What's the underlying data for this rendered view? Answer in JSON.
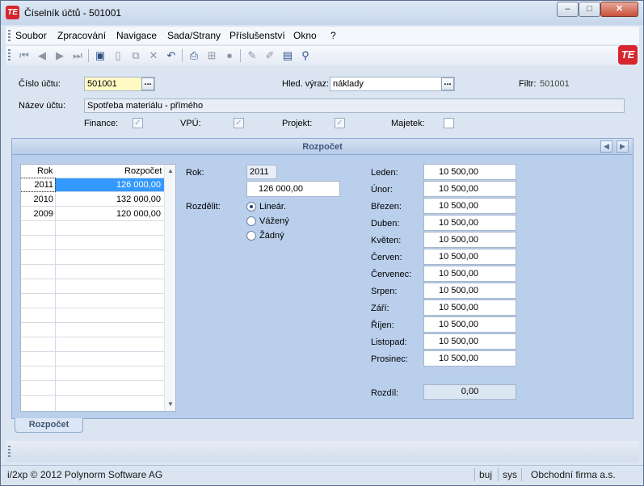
{
  "window": {
    "title": "Číselník účtů - 501001",
    "app_icon": "TE",
    "minimize": "–",
    "maximize": "□",
    "close": "✕"
  },
  "menu": [
    "Soubor",
    "Zpracování",
    "Navigace",
    "Sada/Strany",
    "Příslušenství",
    "Okno",
    "?"
  ],
  "toolbar_icons": [
    "first-icon",
    "previous-icon",
    "next-icon",
    "last-icon",
    "save-icon",
    "new-icon",
    "copy-icon",
    "delete-icon",
    "undo-icon",
    "print-icon",
    "structure-icon",
    "disc-icon",
    "pen-icon",
    "eraser-icon",
    "notes-icon",
    "filter-icon"
  ],
  "brand": "TE",
  "header": {
    "account_label": "Číslo účtu:",
    "account_value": "501001",
    "browse": "...",
    "search_label": "Hled. výraz:",
    "search_value": "náklady",
    "filter_label": "Filtr:",
    "filter_value": "501001",
    "name_label": "Název účtu:",
    "name_value": "Spotřeba materiálu - přímého",
    "checks": [
      {
        "label": "Finance:",
        "checked": true
      },
      {
        "label": "VPÚ:",
        "checked": true
      },
      {
        "label": "Projekt:",
        "checked": true
      },
      {
        "label": "Majetek:",
        "checked": false
      }
    ],
    "check_mark": "✓"
  },
  "panel": {
    "title": "Rozpočet",
    "prev": "◀",
    "next": "▶"
  },
  "grid": {
    "columns": [
      "Rok",
      "Rozpočet"
    ],
    "rows": [
      {
        "rok": "2011",
        "rozpocet": "126 000,00",
        "selected": true
      },
      {
        "rok": "2010",
        "rozpocet": "132 000,00",
        "selected": false
      },
      {
        "rok": "2009",
        "rozpocet": "120 000,00",
        "selected": false
      }
    ],
    "scroll_up": "▲",
    "scroll_down": "▼"
  },
  "detail": {
    "year_label": "Rok:",
    "year_value": "2011",
    "amount_value": "126 000,00",
    "split_label": "Rozdělit:",
    "options": [
      {
        "label": "Lineár.",
        "selected": true
      },
      {
        "label": "Vážený",
        "selected": false
      },
      {
        "label": "Žádný",
        "selected": false
      }
    ]
  },
  "months": [
    {
      "label": "Leden:",
      "value": "10 500,00"
    },
    {
      "label": "Únor:",
      "value": "10 500,00"
    },
    {
      "label": "Březen:",
      "value": "10 500,00"
    },
    {
      "label": "Duben:",
      "value": "10 500,00"
    },
    {
      "label": "Květen:",
      "value": "10 500,00"
    },
    {
      "label": "Červen:",
      "value": "10 500,00"
    },
    {
      "label": "Červenec:",
      "value": "10 500,00"
    },
    {
      "label": "Srpen:",
      "value": "10 500,00"
    },
    {
      "label": "Září:",
      "value": "10 500,00"
    },
    {
      "label": "Říjen:",
      "value": "10 500,00"
    },
    {
      "label": "Listopad:",
      "value": "10 500,00"
    },
    {
      "label": "Prosinec:",
      "value": "10 500,00"
    }
  ],
  "difference": {
    "label": "Rozdíl:",
    "value": "0,00"
  },
  "tabs": [
    "Rozpočet"
  ],
  "status": {
    "copyright": "i/2xp © 2012 Polynorm Software AG",
    "user": "buj",
    "db": "sys",
    "company": "Obchodní firma a.s."
  }
}
